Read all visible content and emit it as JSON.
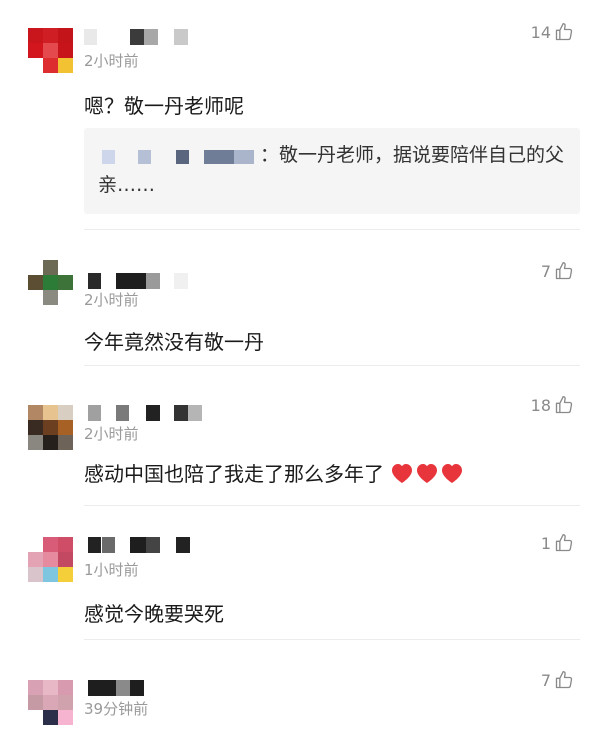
{
  "comments": [
    {
      "time": "2小时前",
      "likes": "14",
      "text": "嗯？敬一丹老师呢",
      "reply": {
        "text": "：敬一丹老师，据说要陪伴自己的父亲……"
      }
    },
    {
      "time": "2小时前",
      "likes": "7",
      "text": "今年竟然没有敬一丹"
    },
    {
      "time": "2小时前",
      "likes": "18",
      "text": "感动中国也陪了我走了那么多年了"
    },
    {
      "time": "1小时前",
      "likes": "1",
      "text": "感觉今晚要哭死"
    },
    {
      "time": "39分钟前",
      "likes": "7",
      "text": ""
    }
  ],
  "icons": {
    "like": "thumbs-up-icon",
    "heart": "red-heart-icon"
  },
  "colors": {
    "heart": "#e8343b",
    "meta_text": "#9a9a9a"
  }
}
